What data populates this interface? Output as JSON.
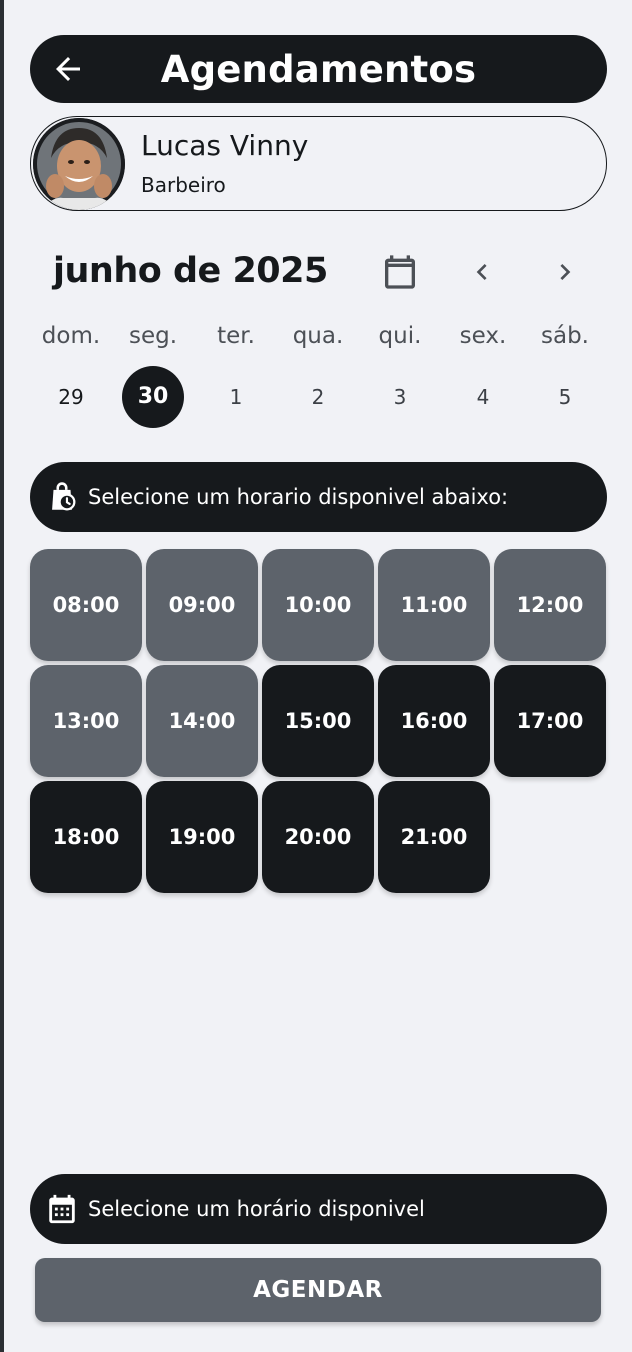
{
  "header": {
    "title": "Agendamentos",
    "back_icon": "arrow-left-icon"
  },
  "barber": {
    "name": "Lucas Vinny",
    "role": "Barbeiro"
  },
  "calendar": {
    "month_label": "junho de 2025",
    "weekdays": [
      "dom.",
      "seg.",
      "ter.",
      "qua.",
      "qui.",
      "sex.",
      "sáb."
    ],
    "days": [
      "29",
      "30",
      "1",
      "2",
      "3",
      "4",
      "5"
    ],
    "selected_day": "30"
  },
  "slots_prompt": "Selecione um horario disponivel abaixo:",
  "slots": [
    {
      "time": "08:00",
      "state": "unavailable"
    },
    {
      "time": "09:00",
      "state": "unavailable"
    },
    {
      "time": "10:00",
      "state": "unavailable"
    },
    {
      "time": "11:00",
      "state": "unavailable"
    },
    {
      "time": "12:00",
      "state": "unavailable"
    },
    {
      "time": "13:00",
      "state": "unavailable"
    },
    {
      "time": "14:00",
      "state": "unavailable"
    },
    {
      "time": "15:00",
      "state": "available"
    },
    {
      "time": "16:00",
      "state": "available"
    },
    {
      "time": "17:00",
      "state": "available"
    },
    {
      "time": "18:00",
      "state": "available"
    },
    {
      "time": "19:00",
      "state": "available"
    },
    {
      "time": "20:00",
      "state": "available"
    },
    {
      "time": "21:00",
      "state": "available"
    }
  ],
  "selection_status": "Selecione um horário disponivel",
  "submit_label": "AGENDAR",
  "colors": {
    "dark": "#16191c",
    "muted": "#5d636b",
    "background": "#f1f2f6"
  }
}
